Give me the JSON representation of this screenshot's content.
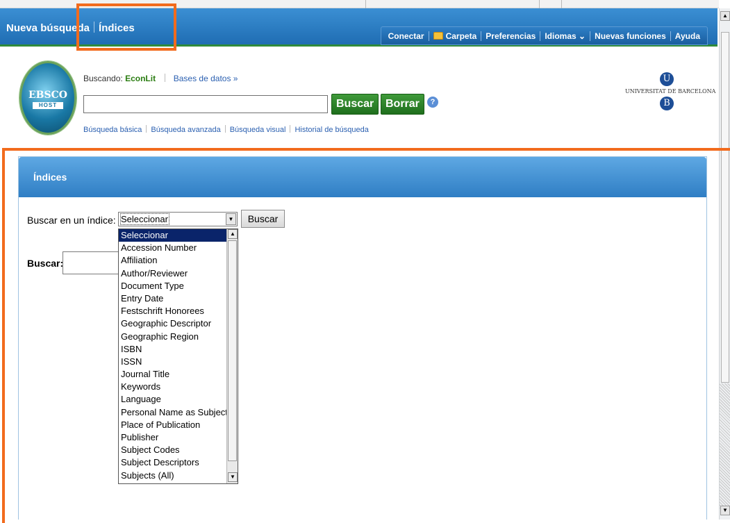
{
  "topbar": {
    "new_search": "Nueva búsqueda",
    "indices": "Índices",
    "toolbar": [
      "Conectar",
      "Carpeta",
      "Preferencias",
      "Idiomas ⌄",
      "Nuevas funciones",
      "Ayuda"
    ]
  },
  "header": {
    "logo_top": "EBSCO",
    "logo_bottom": "HOST",
    "searching_label": "Buscando:",
    "database": "EconLit",
    "databases_link": "Bases de datos »",
    "search_value": "",
    "search_button": "Buscar",
    "clear_button": "Borrar",
    "help": "?",
    "links": [
      "Búsqueda básica",
      "Búsqueda avanzada",
      "Búsqueda visual",
      "Historial de búsqueda"
    ],
    "university_letter_top": "U",
    "university_name": "UNIVERSITAT DE BARCELONA",
    "university_letter_bottom": "B"
  },
  "panel": {
    "title": "Índices",
    "index_label": "Buscar en un índice:",
    "index_selected": "Seleccionar",
    "index_button": "Buscar",
    "search_label": "Buscar:",
    "search_value": "",
    "index_options": [
      "Seleccionar",
      "Accession Number",
      "Affiliation",
      "Author/Reviewer",
      "Document Type",
      "Entry Date",
      "Festschrift Honorees",
      "Geographic Descriptor",
      "Geographic Region",
      "ISBN",
      "ISSN",
      "Journal Title",
      "Keywords",
      "Language",
      "Personal Name as Subject",
      "Place of Publication",
      "Publisher",
      "Subject Codes",
      "Subject Descriptors",
      "Subjects (All)"
    ]
  },
  "colors": {
    "topbar_blue": "#1f6db3",
    "accent_green": "#2f8a3b",
    "highlight_orange": "#f26b1d",
    "selection_navy": "#0a246a"
  }
}
